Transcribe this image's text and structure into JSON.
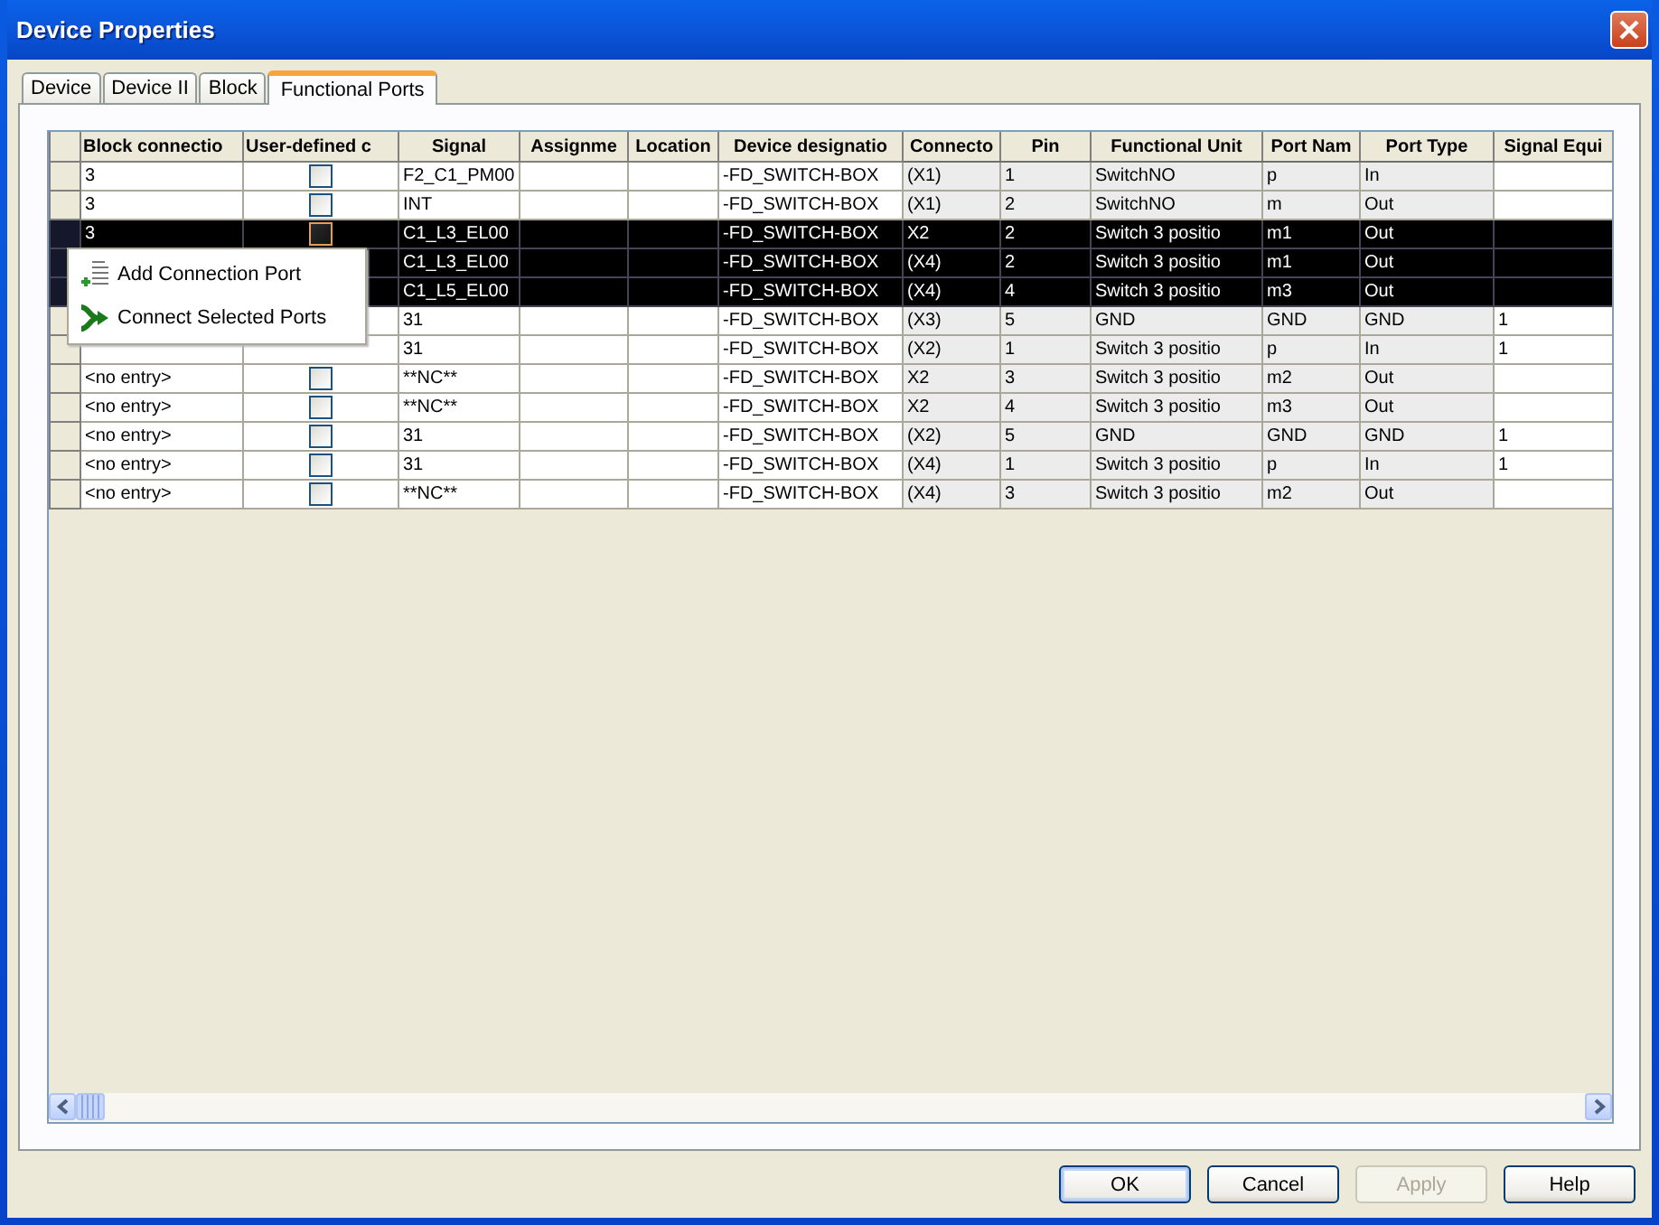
{
  "window": {
    "title": "Device Properties"
  },
  "tabs": [
    {
      "label": "Device",
      "selected": false
    },
    {
      "label": "Device II",
      "selected": false
    },
    {
      "label": "Block",
      "selected": false
    },
    {
      "label": "Functional Ports",
      "selected": true
    }
  ],
  "table": {
    "columns": [
      {
        "label": "Block connectio",
        "kind": "text",
        "readonly": false
      },
      {
        "label": "User-defined c",
        "kind": "checkbox",
        "readonly": false
      },
      {
        "label": "Signal",
        "kind": "text",
        "readonly": false
      },
      {
        "label": "Assignme",
        "kind": "text",
        "readonly": false
      },
      {
        "label": "Location",
        "kind": "text",
        "readonly": false
      },
      {
        "label": "Device designatio",
        "kind": "text",
        "readonly": false
      },
      {
        "label": "Connecto",
        "kind": "text",
        "readonly": true
      },
      {
        "label": "Pin",
        "kind": "text",
        "readonly": true
      },
      {
        "label": "Functional Unit",
        "kind": "text",
        "readonly": true
      },
      {
        "label": "Port Nam",
        "kind": "text",
        "readonly": true
      },
      {
        "label": "Port Type",
        "kind": "text",
        "readonly": true
      },
      {
        "label": "Signal Equi",
        "kind": "text",
        "readonly": false
      }
    ],
    "rows": [
      {
        "selected": false,
        "cells": [
          "3",
          {
            "checked": false
          },
          "F2_C1_PM00",
          null,
          null,
          "-FD_SWITCH-BOX",
          "(X1)",
          "1",
          "SwitchNO",
          "p",
          "In",
          null
        ]
      },
      {
        "selected": false,
        "cells": [
          "3",
          {
            "checked": false
          },
          "INT",
          null,
          null,
          "-FD_SWITCH-BOX",
          "(X1)",
          "2",
          "SwitchNO",
          "m",
          "Out",
          null
        ]
      },
      {
        "selected": true,
        "cells": [
          "3",
          {
            "checked": false
          },
          "C1_L3_EL00",
          null,
          null,
          "-FD_SWITCH-BOX",
          "X2",
          "2",
          "Switch 3 positio",
          "m1",
          "Out",
          null
        ]
      },
      {
        "selected": true,
        "cells": [
          null,
          null,
          "C1_L3_EL00",
          null,
          null,
          "-FD_SWITCH-BOX",
          "(X4)",
          "2",
          "Switch 3 positio",
          "m1",
          "Out",
          null
        ]
      },
      {
        "selected": true,
        "cells": [
          null,
          null,
          "C1_L5_EL00",
          null,
          null,
          "-FD_SWITCH-BOX",
          "(X4)",
          "4",
          "Switch 3 positio",
          "m3",
          "Out",
          null
        ]
      },
      {
        "selected": false,
        "cells": [
          null,
          null,
          "31",
          null,
          null,
          "-FD_SWITCH-BOX",
          "(X3)",
          "5",
          "GND",
          "GND",
          "GND",
          "1"
        ]
      },
      {
        "selected": false,
        "cells": [
          null,
          null,
          "31",
          null,
          null,
          "-FD_SWITCH-BOX",
          "(X2)",
          "1",
          "Switch 3 positio",
          "p",
          "In",
          "1"
        ]
      },
      {
        "selected": false,
        "cells": [
          "<no entry>",
          {
            "checked": false
          },
          "**NC**",
          null,
          null,
          "-FD_SWITCH-BOX",
          "X2",
          "3",
          "Switch 3 positio",
          "m2",
          "Out",
          null
        ]
      },
      {
        "selected": false,
        "cells": [
          "<no entry>",
          {
            "checked": false
          },
          "**NC**",
          null,
          null,
          "-FD_SWITCH-BOX",
          "X2",
          "4",
          "Switch 3 positio",
          "m3",
          "Out",
          null
        ]
      },
      {
        "selected": false,
        "cells": [
          "<no entry>",
          {
            "checked": false
          },
          "31",
          null,
          null,
          "-FD_SWITCH-BOX",
          "(X2)",
          "5",
          "GND",
          "GND",
          "GND",
          "1"
        ]
      },
      {
        "selected": false,
        "cells": [
          "<no entry>",
          {
            "checked": false
          },
          "31",
          null,
          null,
          "-FD_SWITCH-BOX",
          "(X4)",
          "1",
          "Switch 3 positio",
          "p",
          "In",
          "1"
        ]
      },
      {
        "selected": false,
        "cells": [
          "<no entry>",
          {
            "checked": false
          },
          "**NC**",
          null,
          null,
          "-FD_SWITCH-BOX",
          "(X4)",
          "3",
          "Switch 3 positio",
          "m2",
          "Out",
          null
        ]
      }
    ]
  },
  "context_menu": {
    "items": [
      {
        "label": "Add Connection Port",
        "kind": "add"
      },
      {
        "label": "Connect Selected Ports",
        "kind": "connect"
      }
    ]
  },
  "buttons": [
    {
      "label": "OK",
      "disabled": false,
      "default": true
    },
    {
      "label": "Cancel",
      "disabled": false,
      "default": false
    },
    {
      "label": "Apply",
      "disabled": true,
      "default": false
    },
    {
      "label": "Help",
      "disabled": false,
      "default": false
    }
  ]
}
